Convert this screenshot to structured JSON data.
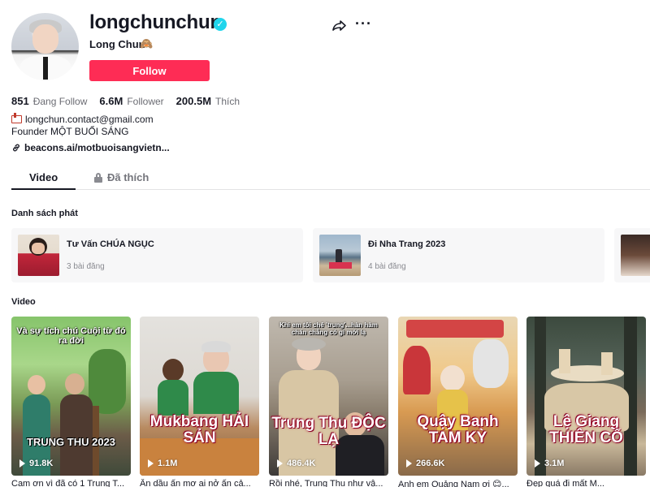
{
  "profile": {
    "username": "longchunchun",
    "nickname": "Long Chun",
    "nickname_emoji": "🙈",
    "follow_label": "Follow",
    "stats": [
      {
        "value": "851",
        "label": "Đang Follow"
      },
      {
        "value": "6.6M",
        "label": "Follower"
      },
      {
        "value": "200.5M",
        "label": "Thích"
      }
    ],
    "bio": {
      "email": "longchun.contact@gmail.com",
      "founder": "Founder MỘT BUỔI SÁNG",
      "link": "beacons.ai/motbuoisangvietn..."
    }
  },
  "tabs": {
    "video": "Video",
    "liked": "Đã thích"
  },
  "sections": {
    "playlists": "Danh sách phát",
    "videos": "Video"
  },
  "playlists": [
    {
      "title": "Tư Vấn CHÚA NGỤC",
      "count": "3 bài đăng"
    },
    {
      "title": "Đi Nha Trang 2023",
      "count": "4 bài đăng"
    }
  ],
  "videos": [
    {
      "overlay_top": "Và sự tích chú Cuội từ đó ra đời",
      "overlay_main": "TRUNG THU 2023",
      "views": "91.8K",
      "caption": "Cam ơn vì đã có 1 Trung T..."
    },
    {
      "overlay_top": "",
      "overlay_main": "Mukbang HẢI SẢN",
      "views": "1.1M",
      "caption": "Ấn dầu ấn mơ ai nở ấn cả..."
    },
    {
      "overlay_top": "Khi em tôi chê 'trung'...hàn hàm chán chẳng có gì mới lạ",
      "overlay_main": "Trung Thu ĐỘC LẠ",
      "views": "486.4K",
      "caption": "Rồi nhé, Trung Thu như vậ..."
    },
    {
      "overlay_top": "",
      "overlay_main": "Quậy Banh TAM KỲ",
      "views": "266.6K",
      "caption": "Anh em Quảng Nam ơi 😊..."
    },
    {
      "overlay_top": "",
      "overlay_main": "Lệ Giang THIÊN CỔ",
      "views": "3.1M",
      "caption": "Đẹp quá đi mất M..."
    }
  ],
  "colors": {
    "accent": "#fe2c55",
    "verified": "#20d5ec",
    "muted": "#6b6c73"
  },
  "icons": [
    "verified-icon",
    "share-icon",
    "more-icon",
    "mail-icon",
    "link-icon",
    "lock-icon",
    "play-icon"
  ]
}
